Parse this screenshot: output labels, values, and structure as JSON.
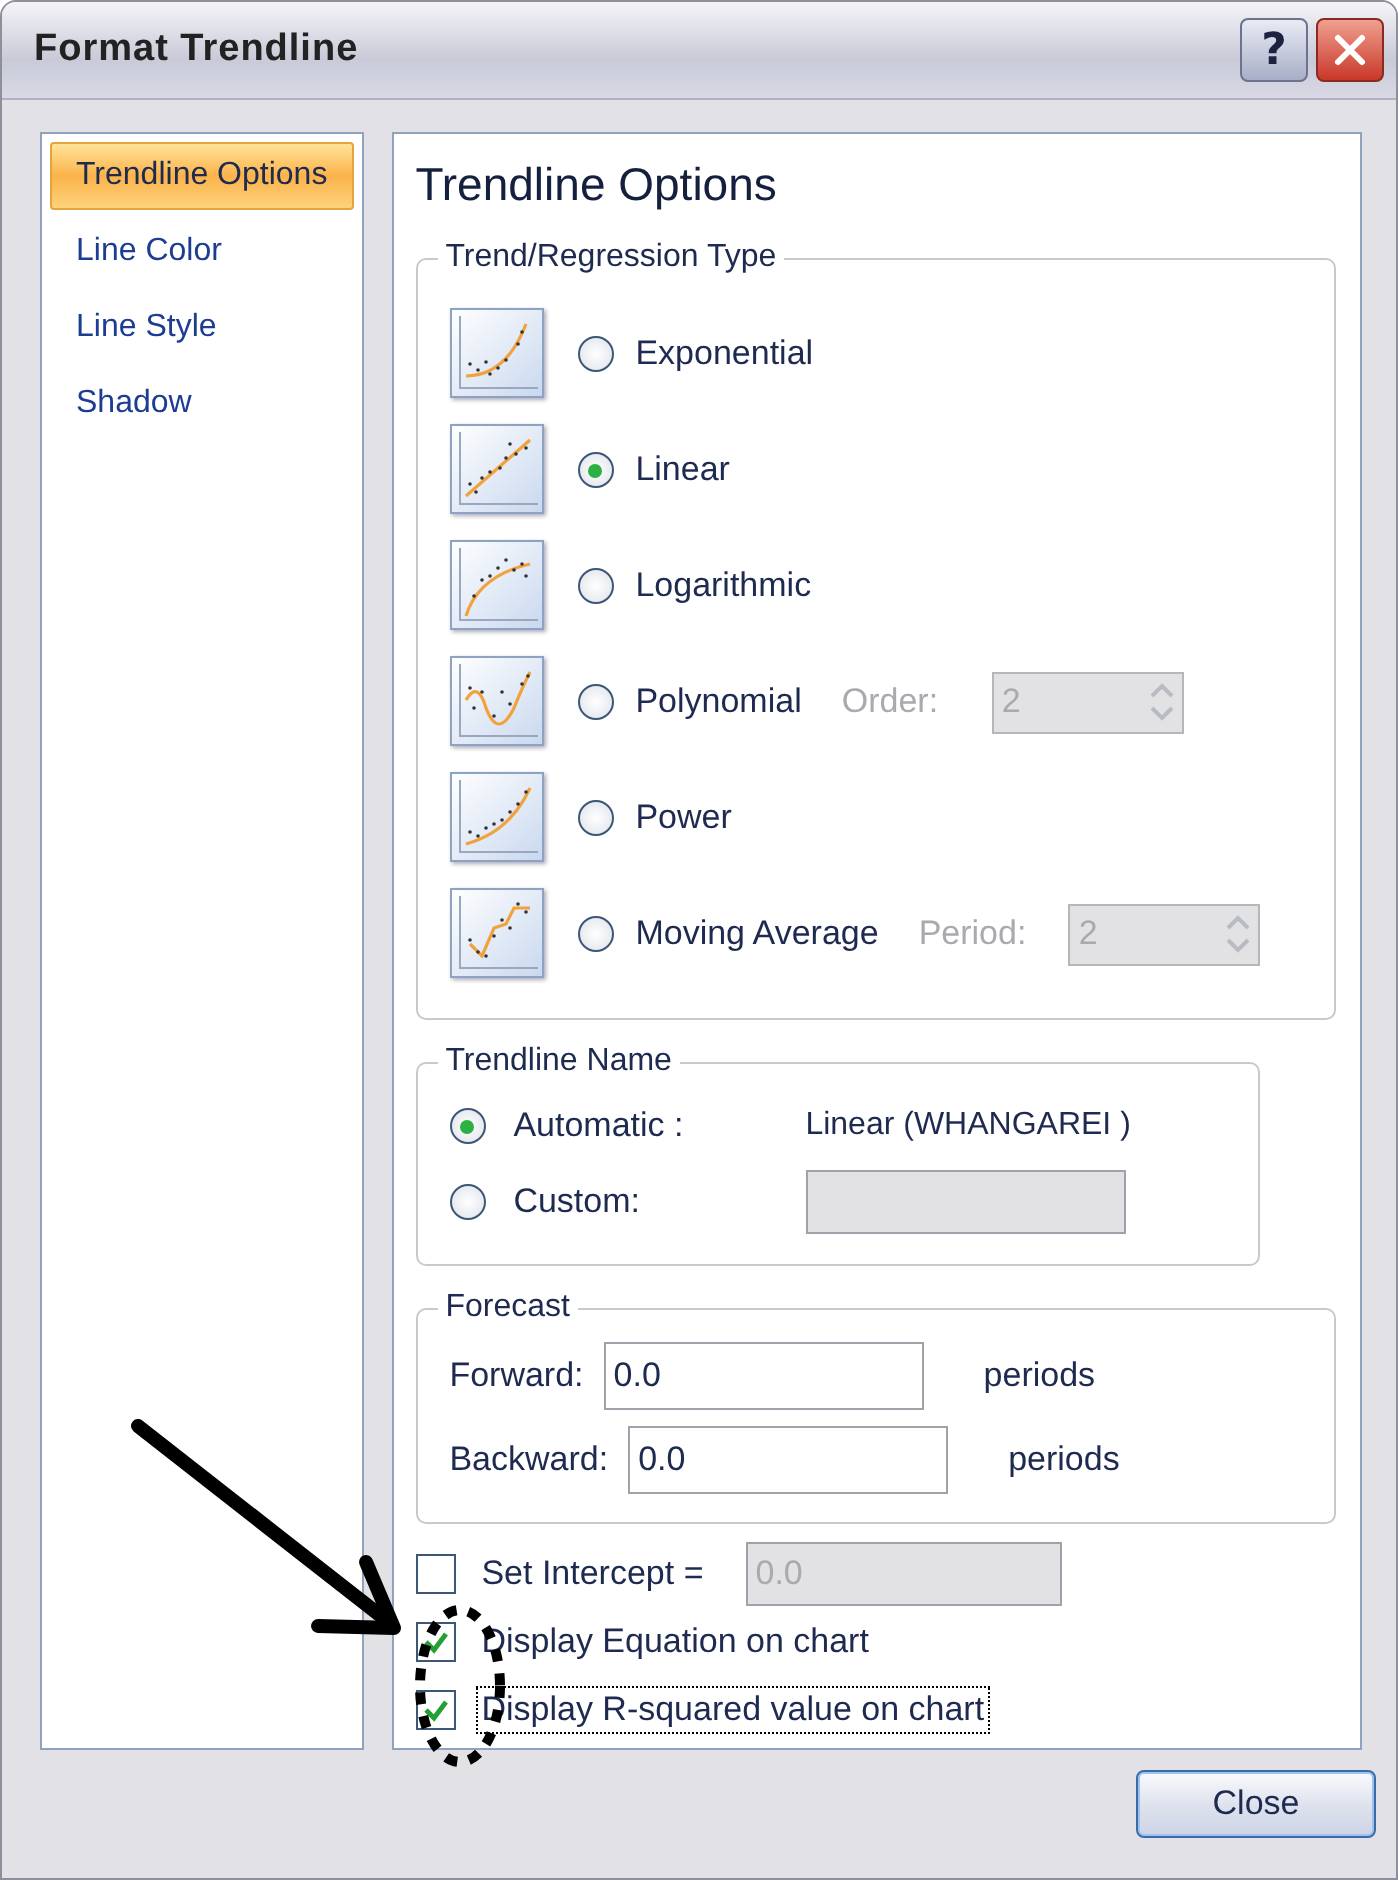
{
  "window": {
    "title": "Format Trendline",
    "help_button": "?"
  },
  "sidebar": {
    "items": [
      {
        "label": "Trendline Options",
        "selected": true
      },
      {
        "label": "Line Color",
        "selected": false
      },
      {
        "label": "Line Style",
        "selected": false
      },
      {
        "label": "Shadow",
        "selected": false
      }
    ]
  },
  "panel": {
    "title": "Trendline Options",
    "regression": {
      "legend": "Trend/Regression Type",
      "types": [
        {
          "kind": "exponential",
          "label": "Exponential",
          "selected": false
        },
        {
          "kind": "linear",
          "label": "Linear",
          "selected": true
        },
        {
          "kind": "logarithmic",
          "label": "Logarithmic",
          "selected": false
        },
        {
          "kind": "polynomial",
          "label": "Polynomial",
          "selected": false,
          "option": {
            "label": "Order:",
            "value": "2",
            "disabled": true
          }
        },
        {
          "kind": "power",
          "label": "Power",
          "selected": false
        },
        {
          "kind": "moving_average",
          "label": "Moving Average",
          "selected": false,
          "option": {
            "label": "Period:",
            "value": "2",
            "disabled": true
          }
        }
      ]
    },
    "name": {
      "legend": "Trendline Name",
      "automatic": {
        "label": "Automatic :",
        "selected": true,
        "value": "Linear (WHANGAREI )"
      },
      "custom": {
        "label": "Custom:",
        "selected": false,
        "disabled": true
      }
    },
    "forecast": {
      "legend": "Forecast",
      "rows": [
        {
          "label": "Forward:",
          "value": "0.0",
          "unit": "periods"
        },
        {
          "label": "Backward:",
          "value": "0.0",
          "unit": "periods"
        }
      ]
    },
    "checkboxes": [
      {
        "label": "Set Intercept =",
        "checked": false,
        "focused": false,
        "field": {
          "value": "0.0",
          "disabled": true
        }
      },
      {
        "label": "Display Equation on chart",
        "checked": true,
        "focused": false
      },
      {
        "label": "Display R-squared value on chart",
        "checked": true,
        "focused": true
      }
    ]
  },
  "buttons": [
    {
      "label": "Close"
    }
  ]
}
